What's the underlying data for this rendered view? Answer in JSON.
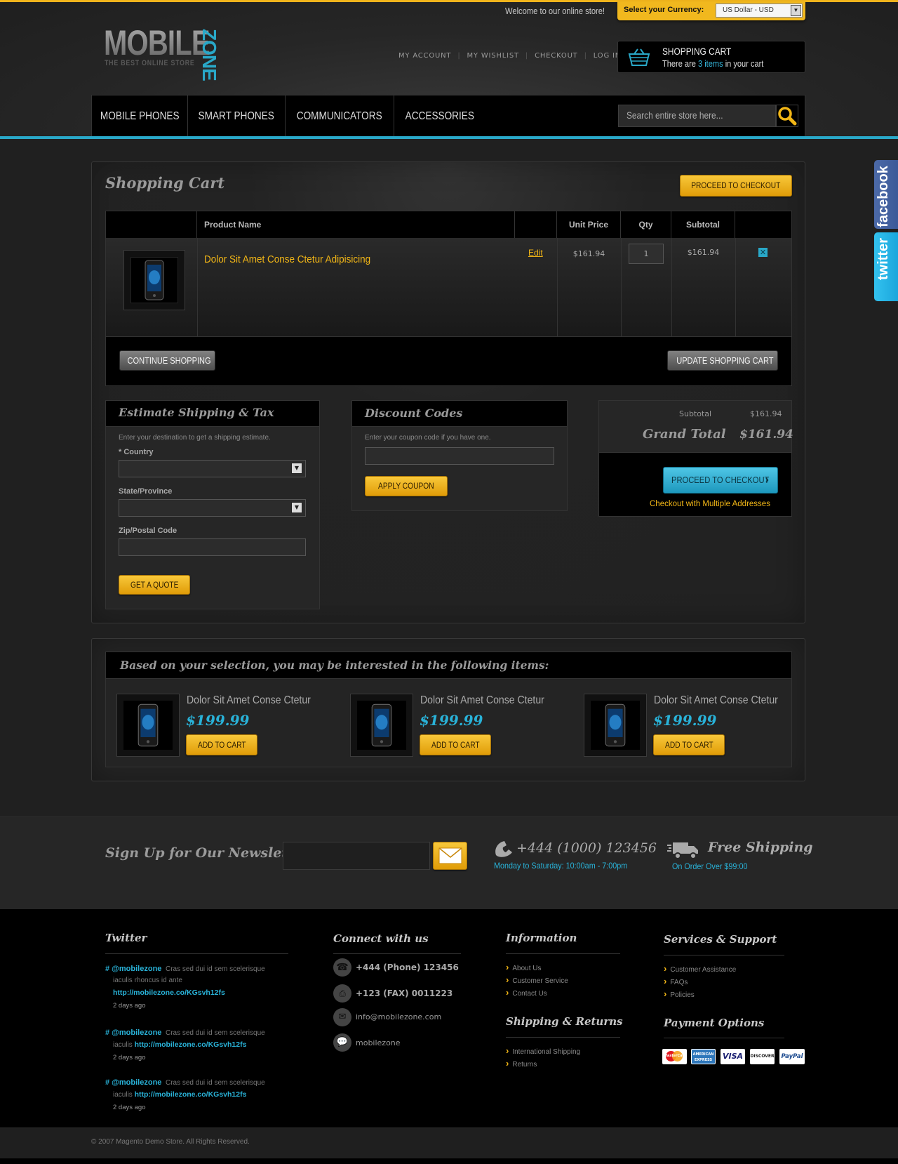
{
  "header": {
    "welcome": "Welcome to our online store!",
    "currency_label": "Select your Currency:",
    "currency_value": "US Dollar - USD",
    "logo_main": "MOBILE",
    "logo_zone": "ZONE",
    "logo_tagline": "THE BEST ONLINE STORE",
    "links": [
      "MY ACCOUNT",
      "MY WISHLIST",
      "CHECKOUT",
      "LOG IN"
    ],
    "cart_title": "SHOPPING CART",
    "cart_prefix": "There are",
    "cart_count": "3 items",
    "cart_suffix": "in your cart"
  },
  "nav": {
    "items": [
      "MOBILE PHONES",
      "SMART PHONES",
      "COMMUNICATORS",
      "ACCESSORIES"
    ],
    "search_placeholder": "Search entire store here..."
  },
  "social": {
    "facebook": "facebook",
    "twitter": "twitter"
  },
  "cart": {
    "title": "Shopping Cart",
    "proceed_top": "PROCEED TO CHECKOUT",
    "columns": {
      "product_name": "Product Name",
      "unit_price": "Unit Price",
      "qty": "Qty",
      "subtotal": "Subtotal"
    },
    "item": {
      "name": "Dolor Sit Amet Conse Ctetur Adipisicing",
      "edit": "Edit",
      "unit_price": "$161.94",
      "qty": "1",
      "subtotal": "$161.94"
    },
    "continue": "CONTINUE SHOPPING",
    "update": "UPDATE SHOPPING CART"
  },
  "shipping": {
    "title": "Estimate Shipping & Tax",
    "intro": "Enter your destination to get a shipping estimate.",
    "country_label": "* Country",
    "state_label": "State/Province",
    "zip_label": "Zip/Postal Code",
    "quote_button": "GET A QUOTE"
  },
  "discount": {
    "title": "Discount Codes",
    "intro": "Enter your coupon code if you have one.",
    "button": "APPLY COUPON"
  },
  "totals": {
    "subtotal_label": "Subtotal",
    "subtotal_value": "$161.94",
    "grand_label": "Grand Total",
    "grand_value": "$161.94",
    "checkout_button": "PROCEED TO CHECKOUT",
    "multi_address": "Checkout with Multiple Addresses"
  },
  "crosssell": {
    "title": "Based on your selection, you may be interested in the following items:",
    "items": [
      {
        "name": "Dolor Sit Amet Conse Ctetur",
        "price": "$199.99",
        "button": "ADD TO CART"
      },
      {
        "name": "Dolor Sit Amet Conse Ctetur",
        "price": "$199.99",
        "button": "ADD TO CART"
      },
      {
        "name": "Dolor Sit Amet Conse Ctetur",
        "price": "$199.99",
        "button": "ADD TO CART"
      }
    ]
  },
  "newsletter": {
    "title": "Sign Up for Our Newsletter",
    "phone": "+444 (1000) 123456",
    "hours": "Monday to Saturday: 10:00am - 7:00pm",
    "shipping_title": "Free Shipping",
    "shipping_sub": "On Order Over $99:00"
  },
  "footer": {
    "twitter_title": "Twitter",
    "tweets": [
      {
        "handle": "# @mobilezone",
        "text1": "Cras sed dui id sem scelerisque",
        "text2": "iaculis rhoncus id ante",
        "link": "http://mobilezone.co/KGsvh12fs",
        "time": "2 days ago"
      },
      {
        "handle": "# @mobilezone",
        "text1": "Cras sed dui id sem scelerisque",
        "text2": "iaculis",
        "link": "http://mobilezone.co/KGsvh12fs",
        "time": "2 days ago"
      },
      {
        "handle": "# @mobilezone",
        "text1": "Cras sed dui id sem scelerisque",
        "text2": "iaculis",
        "link": "http://mobilezone.co/KGsvh12fs",
        "time": "2 days ago"
      }
    ],
    "connect_title": "Connect with us",
    "connect": {
      "phone": "+444 (Phone) 123456",
      "fax": "+123 (FAX) 0011223",
      "email": "info@mobilezone.com",
      "skype": "mobilezone"
    },
    "info_title": "Information",
    "info_links": [
      "About Us",
      "Customer Service",
      "Contact Us"
    ],
    "shipping_title": "Shipping & Returns",
    "shipping_links": [
      "International Shipping",
      "Returns"
    ],
    "services_title": "Services & Support",
    "services_links": [
      "Customer Assistance",
      "FAQs",
      "Policies"
    ],
    "payment_title": "Payment Options",
    "payment_cards": [
      "MasterCard",
      "AMERICAN EXPRESS",
      "VISA",
      "DISCOVER",
      "PayPal"
    ],
    "copyright": "© 2007 Magento Demo Store. All Rights Reserved."
  },
  "colors": {
    "accent_gold": "#f2b616",
    "accent_blue": "#29a8c8",
    "background": "#202020"
  }
}
